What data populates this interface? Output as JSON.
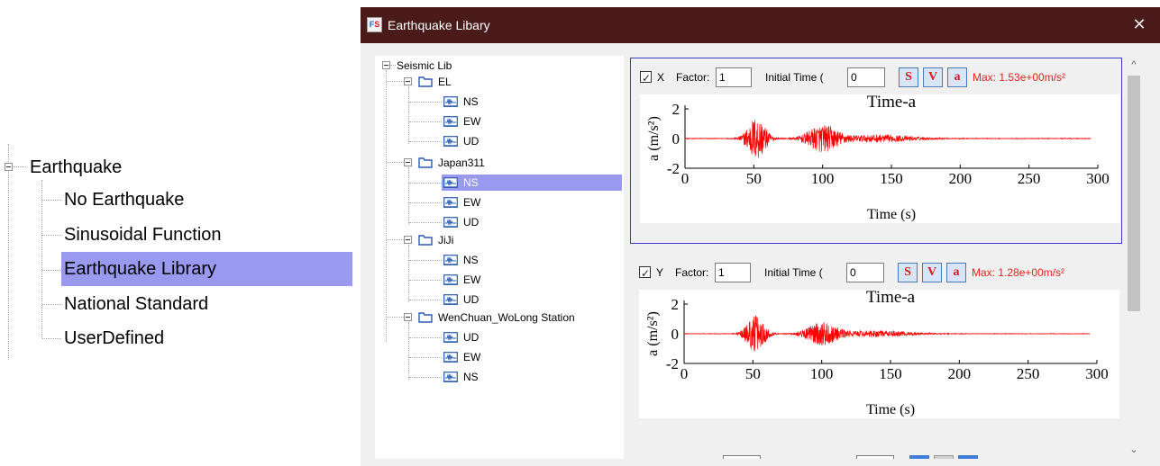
{
  "left_tree": {
    "root_label": "Earthquake",
    "items": [
      {
        "label": "No Earthquake",
        "selected": false
      },
      {
        "label": "Sinusoidal Function",
        "selected": false
      },
      {
        "label": "Earthquake Library",
        "selected": true
      },
      {
        "label": "National Standard",
        "selected": false
      },
      {
        "label": "UserDefined",
        "selected": false
      }
    ]
  },
  "dialog": {
    "title": "Earthquake Libary",
    "close_glyph": "✕",
    "app_icon_text": {
      "a": "F",
      "b": "S"
    }
  },
  "seismic_tree": {
    "root": "Seismic Lib",
    "groups": [
      {
        "name": "EL",
        "children": [
          "NS",
          "EW",
          "UD"
        ]
      },
      {
        "name": "Japan311",
        "children": [
          "NS",
          "EW",
          "UD"
        ],
        "selected_child": 0
      },
      {
        "name": "JiJi",
        "children": [
          "NS",
          "EW",
          "UD"
        ]
      },
      {
        "name": "WenChuan_WoLong Station",
        "children": [
          "UD",
          "EW",
          "NS"
        ]
      }
    ]
  },
  "channels": [
    {
      "axis": "X",
      "checked": true,
      "factor_label": "Factor:",
      "factor_value": "1",
      "initial_time_label": "Initial Time (",
      "initial_time_value": "0",
      "tool_icons": [
        "s-icon",
        "v-icon",
        "a-icon"
      ],
      "tool_glyphs": [
        "S",
        "V",
        "a"
      ],
      "max_text": "Max: 1.53e+00m/s²"
    },
    {
      "axis": "Y",
      "checked": true,
      "factor_label": "Factor:",
      "factor_value": "1",
      "initial_time_label": "Initial Time (",
      "initial_time_value": "0",
      "tool_icons": [
        "s-icon",
        "v-icon",
        "a-icon"
      ],
      "tool_glyphs": [
        "S",
        "V",
        "a"
      ],
      "max_text": "Max: 1.28e+00m/s²"
    }
  ],
  "scrollbar": {
    "up_glyph": "^",
    "down_glyph": "⌄"
  },
  "colors": {
    "accent_selection": "#9999f0",
    "titlebar": "#4a1a1a",
    "signal": "#ff0000",
    "max_text": "#e0241d",
    "active_border": "#3c3cc8"
  },
  "chart_data": [
    {
      "type": "line",
      "title": "Time-a",
      "xlabel": "Time (s)",
      "ylabel": "a (m/s²)",
      "xlim": [
        0,
        300
      ],
      "ylim": [
        -2,
        2
      ],
      "xticks": [
        0,
        50,
        100,
        150,
        200,
        250,
        300
      ],
      "yticks": [
        -2,
        0,
        2
      ],
      "series": [
        {
          "color": "#ff0000",
          "peak_abs": 1.53,
          "x_range": [
            0,
            295
          ]
        }
      ]
    },
    {
      "type": "line",
      "title": "Time-a",
      "xlabel": "Time (s)",
      "ylabel": "a (m/s²)",
      "xlim": [
        0,
        300
      ],
      "ylim": [
        -2,
        2
      ],
      "xticks": [
        0,
        50,
        100,
        150,
        200,
        250,
        300
      ],
      "yticks": [
        -2,
        0,
        2
      ],
      "series": [
        {
          "color": "#ff0000",
          "peak_abs": 1.28,
          "x_range": [
            0,
            295
          ]
        }
      ]
    }
  ]
}
